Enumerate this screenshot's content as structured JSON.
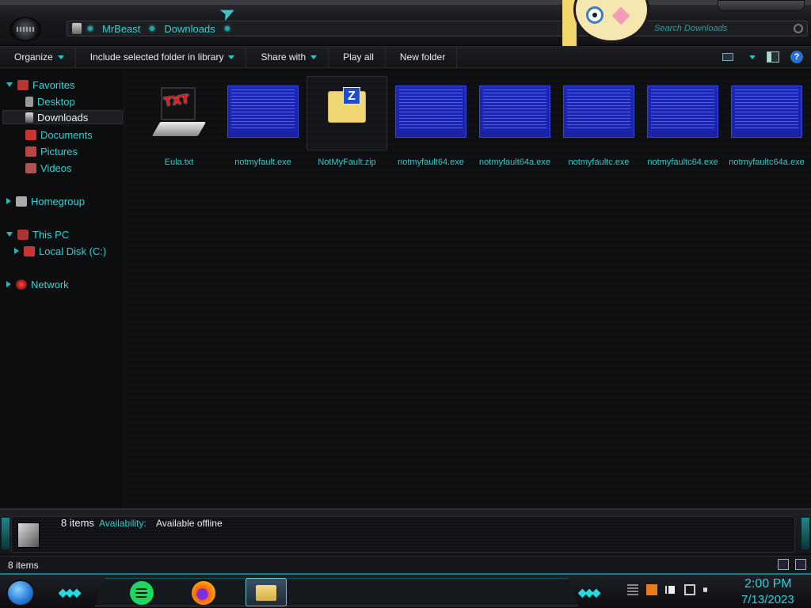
{
  "address": {
    "crumbs": [
      "MrBeast",
      "Downloads"
    ],
    "search_placeholder": "Search Downloads"
  },
  "toolbar": {
    "organize": "Organize",
    "include_library": "Include selected folder in library",
    "share_with": "Share with",
    "play_all": "Play all",
    "new_folder": "New folder"
  },
  "nav": {
    "favorites": "Favorites",
    "desktop": "Desktop",
    "downloads": "Downloads",
    "documents": "Documents",
    "pictures": "Pictures",
    "videos": "Videos",
    "homegroup": "Homegroup",
    "this_pc": "This PC",
    "local_disk": "Local Disk (C:)",
    "network": "Network"
  },
  "files": [
    {
      "name": "Eula.txt",
      "icon": "txt-file-icon"
    },
    {
      "name": "notmyfault.exe",
      "icon": "bsod-thumbnail"
    },
    {
      "name": "NotMyFault.zip",
      "icon": "zip-folder-icon"
    },
    {
      "name": "notmyfault64.exe",
      "icon": "bsod-thumbnail"
    },
    {
      "name": "notmyfault64a.exe",
      "icon": "bsod-thumbnail"
    },
    {
      "name": "notmyfaultc.exe",
      "icon": "bsod-thumbnail"
    },
    {
      "name": "notmyfaultc64.exe",
      "icon": "bsod-thumbnail"
    },
    {
      "name": "notmyfaultc64a.exe",
      "icon": "bsod-thumbnail"
    }
  ],
  "details": {
    "count": "8 items",
    "availability_label": "Availability:",
    "availability_value": "Available offline"
  },
  "status": {
    "count": "8 items"
  },
  "taskbar": {
    "time": "2:00 PM",
    "date": "7/13/2023"
  },
  "colors": {
    "accent": "#35d0d0",
    "background": "#0d0e10"
  }
}
